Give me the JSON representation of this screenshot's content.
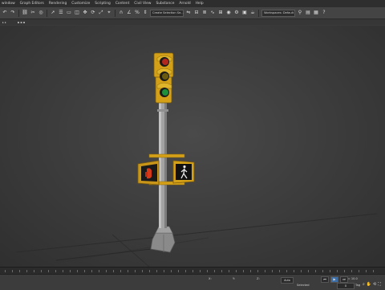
{
  "menu": [
    "window",
    "Graph Editors",
    "Rendering",
    "Customize",
    "Scripting",
    "Content",
    "Civil View",
    "Substance",
    "Arnold",
    "Help"
  ],
  "toolbar": {
    "icons": [
      "undo-icon",
      "redo-icon",
      "link-icon",
      "unlink-icon",
      "bind-icon",
      "select-icon",
      "select-list-icon",
      "region-icon",
      "window-crossing-icon",
      "move-icon",
      "rotate-icon",
      "scale-icon",
      "place-icon"
    ],
    "selection_filter": "Create Selection Se...",
    "right_icons": [
      "mirror-icon",
      "align-icon",
      "layers-icon",
      "curve-editor-icon",
      "schematic-icon",
      "material-icon",
      "render-setup-icon",
      "render-frame-icon",
      "render-icon"
    ],
    "workspace": "Workspaces: Default"
  },
  "viewport": {
    "label": "[+] [Perspective] [Standard] [Default Shading]"
  },
  "statusbar": {
    "left_text": "",
    "coords": {
      "x": "X:",
      "y": "Y:",
      "z": "Z:"
    },
    "grid": "Grid = 10.0",
    "add_time_tag": "Add Time Tag",
    "frame": "0",
    "keys_label": "Selected",
    "auto_key": "Auto"
  },
  "colors": {
    "pole": "#9a9a9a",
    "housing": "#d4a017",
    "red_light": "#c0392b",
    "green_light": "#1e8f3a",
    "walk_white": "#e8e8e8",
    "dont_walk": "#d33a1a"
  }
}
